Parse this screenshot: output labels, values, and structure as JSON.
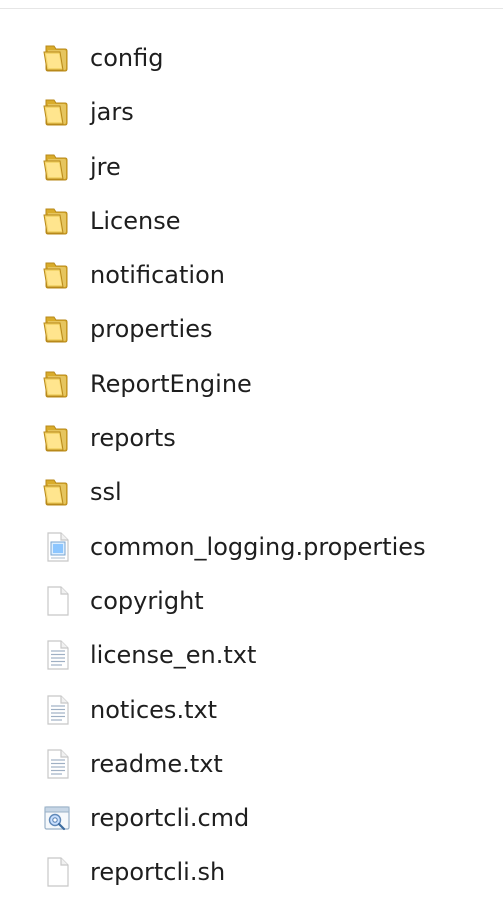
{
  "items": [
    {
      "name": "config",
      "type": "folder",
      "icon": "folder-icon"
    },
    {
      "name": "jars",
      "type": "folder",
      "icon": "folder-icon"
    },
    {
      "name": "jre",
      "type": "folder",
      "icon": "folder-icon"
    },
    {
      "name": "License",
      "type": "folder",
      "icon": "folder-icon"
    },
    {
      "name": "notification",
      "type": "folder",
      "icon": "folder-icon"
    },
    {
      "name": "properties",
      "type": "folder",
      "icon": "folder-icon"
    },
    {
      "name": "ReportEngine",
      "type": "folder",
      "icon": "folder-icon"
    },
    {
      "name": "reports",
      "type": "folder",
      "icon": "folder-icon"
    },
    {
      "name": "ssl",
      "type": "folder",
      "icon": "folder-icon"
    },
    {
      "name": "common_logging.properties",
      "type": "properties",
      "icon": "properties-file-icon"
    },
    {
      "name": "copyright",
      "type": "blank",
      "icon": "blank-file-icon"
    },
    {
      "name": "license_en.txt",
      "type": "text",
      "icon": "text-file-icon"
    },
    {
      "name": "notices.txt",
      "type": "text",
      "icon": "text-file-icon"
    },
    {
      "name": "readme.txt",
      "type": "text",
      "icon": "text-file-icon"
    },
    {
      "name": "reportcli.cmd",
      "type": "script",
      "icon": "script-file-icon"
    },
    {
      "name": "reportcli.sh",
      "type": "blank",
      "icon": "blank-file-icon"
    }
  ],
  "colors": {
    "folder_front": "#f4d56b",
    "folder_back": "#d9ac2b",
    "folder_edge": "#b8891a",
    "file_edge": "#c8c8c8",
    "text": "#1e1e1e"
  }
}
